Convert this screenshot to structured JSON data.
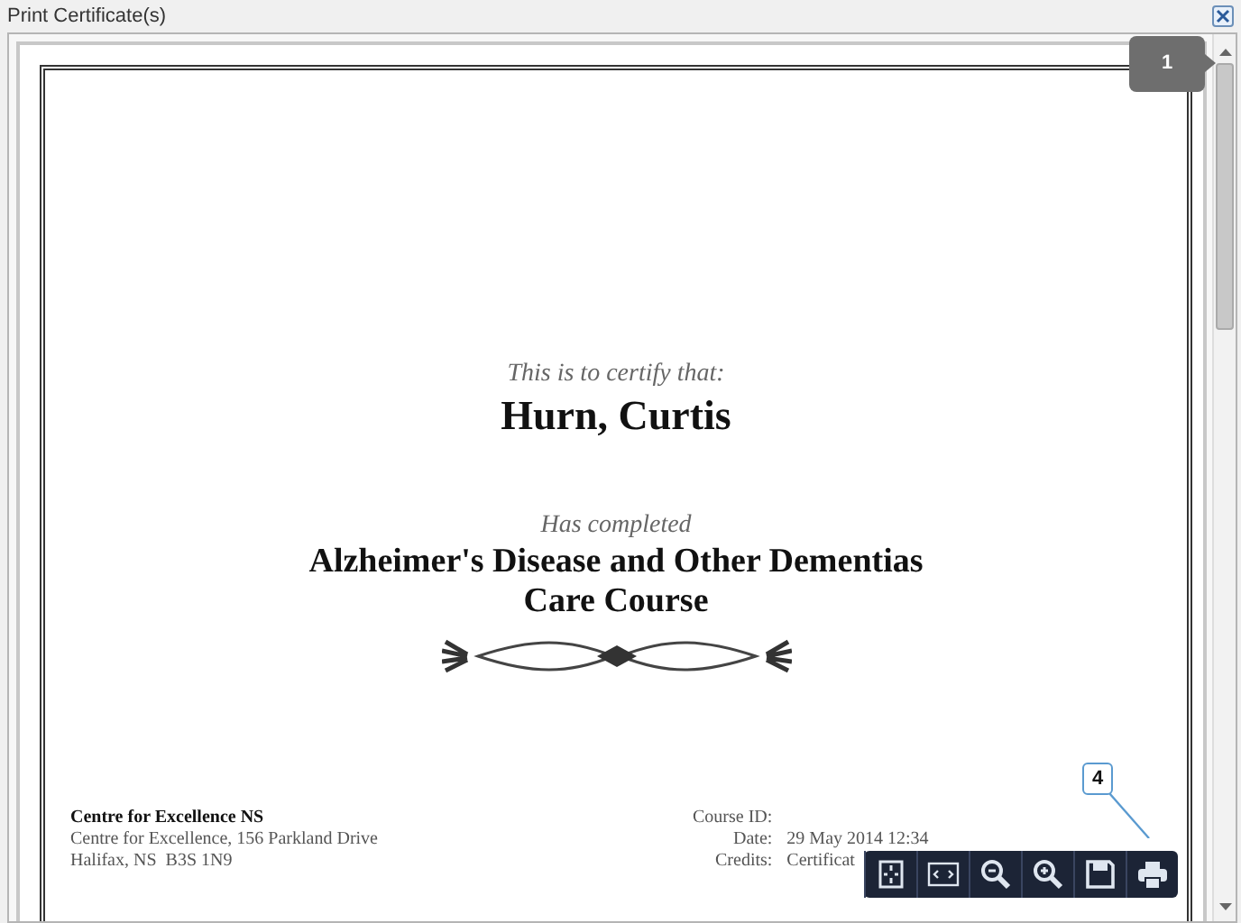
{
  "window": {
    "title": "Print Certificate(s)"
  },
  "certificate": {
    "intro": "This is to certify that:",
    "recipient": "Hurn, Curtis",
    "completed_label": "Has completed",
    "course_lines": [
      "Alzheimer's Disease and Other Dementias",
      "Care Course"
    ],
    "organization": {
      "name": "Centre for Excellence NS",
      "address_lines": [
        "Centre for Excellence, 156 Parkland Drive",
        "Halifax, NS  B3S 1N9"
      ]
    },
    "details": [
      {
        "label": "Course ID:"
      },
      {
        "label": "Date:",
        "value": "29 May 2014 12:34"
      },
      {
        "label": "Credits:",
        "value": "Certificat"
      }
    ]
  },
  "callouts": [
    {
      "text": "1"
    },
    {
      "text": "4"
    }
  ],
  "toolbar": {
    "buttons": [
      {
        "kind": "fit-page"
      },
      {
        "kind": "fit-width"
      },
      {
        "kind": "zoom-out"
      },
      {
        "kind": "zoom-in"
      },
      {
        "kind": "save"
      },
      {
        "kind": "print"
      }
    ]
  }
}
